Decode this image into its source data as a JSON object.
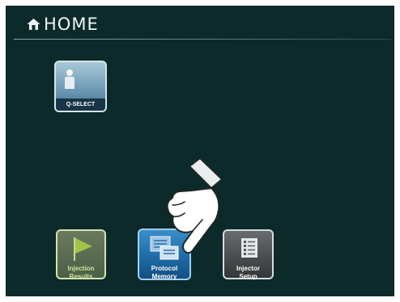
{
  "header": {
    "title": "HOME",
    "icon": "home-icon"
  },
  "tiles": {
    "q_select": {
      "label": "Q-SELECT",
      "icon": "person-icon"
    },
    "injection_results": {
      "line1": "Injection",
      "line2": "Results",
      "icon": "flag-icon"
    },
    "protocol_memory": {
      "line1": "Protocol",
      "line2": "Memory",
      "icon": "protocol-memory-icon"
    },
    "injector_setup": {
      "line1": "Injector",
      "line2": "Setup",
      "icon": "clipboard-icon"
    }
  },
  "overlay": {
    "icon": "pointing-hand-icon"
  },
  "colors": {
    "background": "#0c2a2a",
    "q_select": "#6f9bb5",
    "injection_results": "#566a50",
    "protocol_memory": "#1f6ca8",
    "injector_setup": "#474b4b"
  }
}
